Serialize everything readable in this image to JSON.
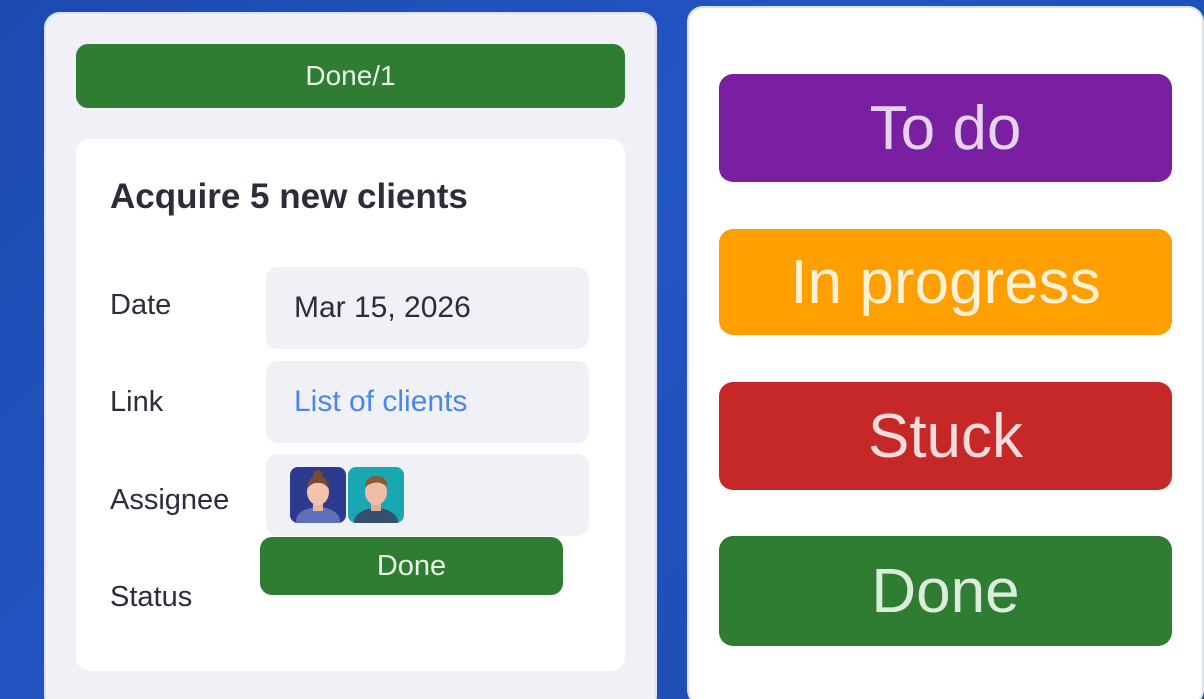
{
  "group": {
    "header": "Done/1"
  },
  "item": {
    "title": "Acquire 5 new clients",
    "fields": {
      "date": {
        "label": "Date",
        "value": "Mar 15, 2026"
      },
      "link": {
        "label": "Link",
        "value": "List of clients"
      },
      "assignee": {
        "label": "Assignee",
        "avatars": [
          "woman-avatar",
          "man-avatar"
        ]
      },
      "status": {
        "label": "Status",
        "value": "Done"
      }
    }
  },
  "status_options": [
    {
      "label": "To do",
      "color": "#7b1fa2",
      "text_color": "#e6d3ef"
    },
    {
      "label": "In progress",
      "color": "#ffa000",
      "text_color": "#fff1d6"
    },
    {
      "label": "Stuck",
      "color": "#c62828",
      "text_color": "#f6dcdc"
    },
    {
      "label": "Done",
      "color": "#2e7d32",
      "text_color": "#dcecdc"
    }
  ],
  "colors": {
    "done_green": "#2e7d32",
    "link_blue": "#4d86ea",
    "background_blue": "#2255c4"
  }
}
